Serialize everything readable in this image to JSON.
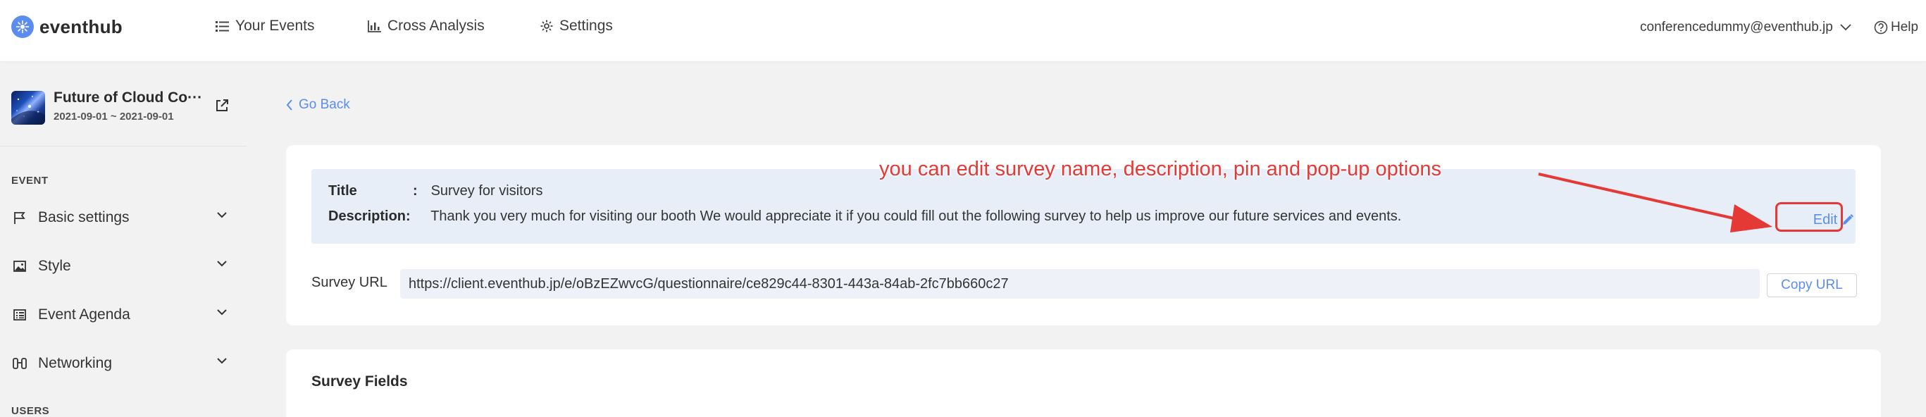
{
  "topbar": {
    "brand": "eventhub",
    "nav": [
      {
        "label": "Your Events",
        "icon": "list-icon"
      },
      {
        "label": "Cross Analysis",
        "icon": "bar-chart-icon"
      },
      {
        "label": "Settings",
        "icon": "gear-icon"
      }
    ],
    "user_email": "conferencedummy@eventhub.jp",
    "help_label": "Help"
  },
  "sidebar": {
    "event": {
      "name": "Future of Cloud Co···",
      "dates": "2021-09-01 ~ 2021-09-01"
    },
    "event_section_label": "EVENT",
    "items": [
      {
        "label": "Basic settings",
        "icon": "flag-icon"
      },
      {
        "label": "Style",
        "icon": "image-icon"
      },
      {
        "label": "Event Agenda",
        "icon": "agenda-icon"
      },
      {
        "label": "Networking",
        "icon": "binoculars-icon"
      }
    ],
    "users_section_label": "USERS"
  },
  "main": {
    "go_back": "Go Back",
    "survey": {
      "title_key": "Title",
      "title_sep": ":",
      "title_value": "Survey for visitors",
      "description_key": "Description:",
      "description_value": "Thank you very much for visiting our booth We would appreciate it if you could fill out the following survey to help us improve our future services and events.",
      "edit_label": "Edit",
      "url_label": "Survey URL",
      "url_value": "https://client.eventhub.jp/e/oBzEZwvcG/questionnaire/ce829c44-8301-443a-84ab-2fc7bb660c27",
      "copy_label": "Copy URL"
    },
    "fields_title": "Survey Fields"
  },
  "annotation": {
    "text": "you can edit survey name, description, pin and pop-up options",
    "color": "#e53935"
  },
  "colors": {
    "accent": "#5b8def",
    "background": "#f2f2f2",
    "info_box": "#e8eef8"
  }
}
